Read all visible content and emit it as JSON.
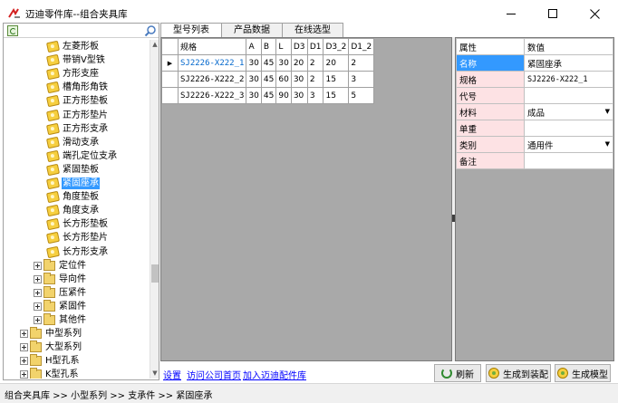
{
  "window": {
    "title": "迈迪零件库--组合夹具库"
  },
  "tree": {
    "items": [
      {
        "label": "左菱形板",
        "kind": "part"
      },
      {
        "label": "带销V型铁",
        "kind": "part"
      },
      {
        "label": "方形支座",
        "kind": "part"
      },
      {
        "label": "槽角形角铁",
        "kind": "part"
      },
      {
        "label": "正方形垫板",
        "kind": "part"
      },
      {
        "label": "正方形垫片",
        "kind": "part"
      },
      {
        "label": "正方形支承",
        "kind": "part"
      },
      {
        "label": "滑动支承",
        "kind": "part"
      },
      {
        "label": "端孔定位支承",
        "kind": "part"
      },
      {
        "label": "紧固垫板",
        "kind": "part"
      },
      {
        "label": "紧固座承",
        "kind": "part",
        "selected": true
      },
      {
        "label": "角度垫板",
        "kind": "part"
      },
      {
        "label": "角度支承",
        "kind": "part"
      },
      {
        "label": "长方形垫板",
        "kind": "part"
      },
      {
        "label": "长方形垫片",
        "kind": "part"
      },
      {
        "label": "长方形支承",
        "kind": "part"
      },
      {
        "label": "定位件",
        "kind": "folder"
      },
      {
        "label": "导向件",
        "kind": "folder"
      },
      {
        "label": "压紧件",
        "kind": "folder"
      },
      {
        "label": "紧固件",
        "kind": "folder"
      },
      {
        "label": "其他件",
        "kind": "folder"
      },
      {
        "label": "中型系列",
        "kind": "folder"
      },
      {
        "label": "大型系列",
        "kind": "folder"
      },
      {
        "label": "H型孔系",
        "kind": "folder"
      },
      {
        "label": "K型孔系",
        "kind": "folder"
      }
    ]
  },
  "tabs": [
    {
      "label": "型号列表",
      "active": true
    },
    {
      "label": "产品数据",
      "active": false
    },
    {
      "label": "在线选型",
      "active": false
    }
  ],
  "grid": {
    "columns": [
      "规格",
      "A",
      "B",
      "L",
      "D3",
      "D1",
      "D3_2",
      "D1_2"
    ],
    "rows": [
      [
        "SJ2226-X222_1",
        "30",
        "45",
        "30",
        "20",
        "2",
        "20",
        "2"
      ],
      [
        "SJ2226-X222_2",
        "30",
        "45",
        "60",
        "30",
        "2",
        "15",
        "3"
      ],
      [
        "SJ2226-X222_3",
        "30",
        "45",
        "90",
        "30",
        "3",
        "15",
        "5"
      ]
    ],
    "current_row_marker": "▶"
  },
  "properties": {
    "header": {
      "name": "属性",
      "value": "数值"
    },
    "rows": [
      {
        "name": "名称",
        "value": "紧固座承",
        "dropdown": false
      },
      {
        "name": "规格",
        "value": "SJ2226-X222_1",
        "dropdown": false
      },
      {
        "name": "代号",
        "value": "",
        "dropdown": false
      },
      {
        "name": "材料",
        "value": "成品",
        "dropdown": true
      },
      {
        "name": "单重",
        "value": "",
        "dropdown": false
      },
      {
        "name": "类别",
        "value": "通用件",
        "dropdown": true
      },
      {
        "name": "备注",
        "value": "",
        "dropdown": false
      }
    ]
  },
  "bottom": {
    "links": [
      "设置",
      "访问公司首页",
      "加入迈迪配件库"
    ],
    "buttons": [
      "刷新",
      "生成到装配",
      "生成模型"
    ]
  },
  "status": {
    "breadcrumb": "组合夹具库 >> 小型系列 >> 支承件 >> 紧固座承"
  },
  "colors": {
    "selection": "#3399ff",
    "property_name_bg": "#fde2e4",
    "grid_background": "#a9a9a9",
    "link": "#0000ff"
  }
}
